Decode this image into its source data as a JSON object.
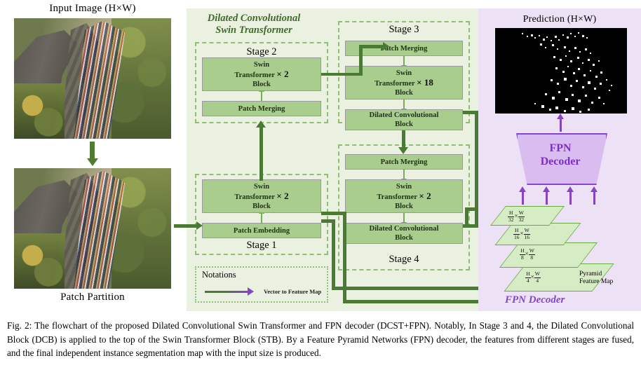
{
  "figure": {
    "caption": "Fig. 2: The flowchart of the proposed Dilated Convolutional Swin Transformer and FPN decoder (DCST+FPN). Notably, In Stage 3 and 4, the Dilated Convolutional Block (DCB) is applied to the top of the Swin Transformer Block (STB). By a Feature Pyramid Networks (FPN) decoder, the features from different stages are fused, and the final independent instance segmentation map with the input size is produced."
  },
  "left_panel": {
    "input_title": "Input Image (H×W)",
    "patch_partition_label": "Patch Partition"
  },
  "backbone": {
    "region_title_line1": "Dilated Convolutional",
    "region_title_line2": "Swin Transformer",
    "stages": [
      {
        "label": "Stage 1",
        "blocks": [
          {
            "name": "patch-embedding",
            "text": "Patch Embedding",
            "multiplier": ""
          },
          {
            "name": "swin-transformer-block",
            "line1": "Swin",
            "line2": "Transformer",
            "line3": "Block",
            "multiplier": "× 2"
          }
        ]
      },
      {
        "label": "Stage 2",
        "blocks": [
          {
            "name": "patch-merging",
            "text": "Patch Merging",
            "multiplier": ""
          },
          {
            "name": "swin-transformer-block",
            "line1": "Swin",
            "line2": "Transformer",
            "line3": "Block",
            "multiplier": "× 2"
          }
        ]
      },
      {
        "label": "Stage 3",
        "blocks": [
          {
            "name": "patch-merging",
            "text": "Patch Merging",
            "multiplier": ""
          },
          {
            "name": "swin-transformer-block",
            "line1": "Swin",
            "line2": "Transformer",
            "line3": "Block",
            "multiplier": "× 18"
          },
          {
            "name": "dilated-convolutional-block",
            "line1": "Dilated Convolutional",
            "line2": "Block",
            "multiplier": ""
          }
        ]
      },
      {
        "label": "Stage 4",
        "blocks": [
          {
            "name": "patch-merging",
            "text": "Patch Merging",
            "multiplier": ""
          },
          {
            "name": "swin-transformer-block",
            "line1": "Swin",
            "line2": "Transformer",
            "line3": "Block",
            "multiplier": "× 2"
          },
          {
            "name": "dilated-convolutional-block",
            "line1": "Dilated Convolutional",
            "line2": "Block",
            "multiplier": ""
          }
        ]
      }
    ],
    "notations": {
      "title": "Notations",
      "arrow_label": "Vector to Feature Map"
    }
  },
  "fpn": {
    "prediction_title": "Prediction (H×W)",
    "decoder_line1": "FPN",
    "decoder_line2": "Decoder",
    "region_caption": "FPN Decoder",
    "pyramid_name_line1": "Pyramid",
    "pyramid_name_line2": "Feature Map",
    "feature_maps": [
      {
        "numerator": "H",
        "denominator": "32",
        "numerator2": "W",
        "denominator2": "32",
        "text": "H/32 × W/32"
      },
      {
        "numerator": "H",
        "denominator": "16",
        "numerator2": "W",
        "denominator2": "16",
        "text": "H/16 × W/16"
      },
      {
        "numerator": "H",
        "denominator": "8",
        "numerator2": "W",
        "denominator2": "8",
        "text": "H/8 × W/8"
      },
      {
        "numerator": "H",
        "denominator": "4",
        "numerator2": "W",
        "denominator2": "4",
        "text": "H/4 × W/4"
      }
    ]
  },
  "colors": {
    "backbone_bg": "#eaf1e0",
    "fpn_bg": "#ede1f5",
    "block_fill": "#a8cd8c",
    "stage_dash": "#8fc070",
    "arrow_green": "#4a7a33",
    "arrow_purple": "#8645c7",
    "feature_map_fill": "#d6ecc4",
    "decoder_fill": "#d9bdf0"
  }
}
